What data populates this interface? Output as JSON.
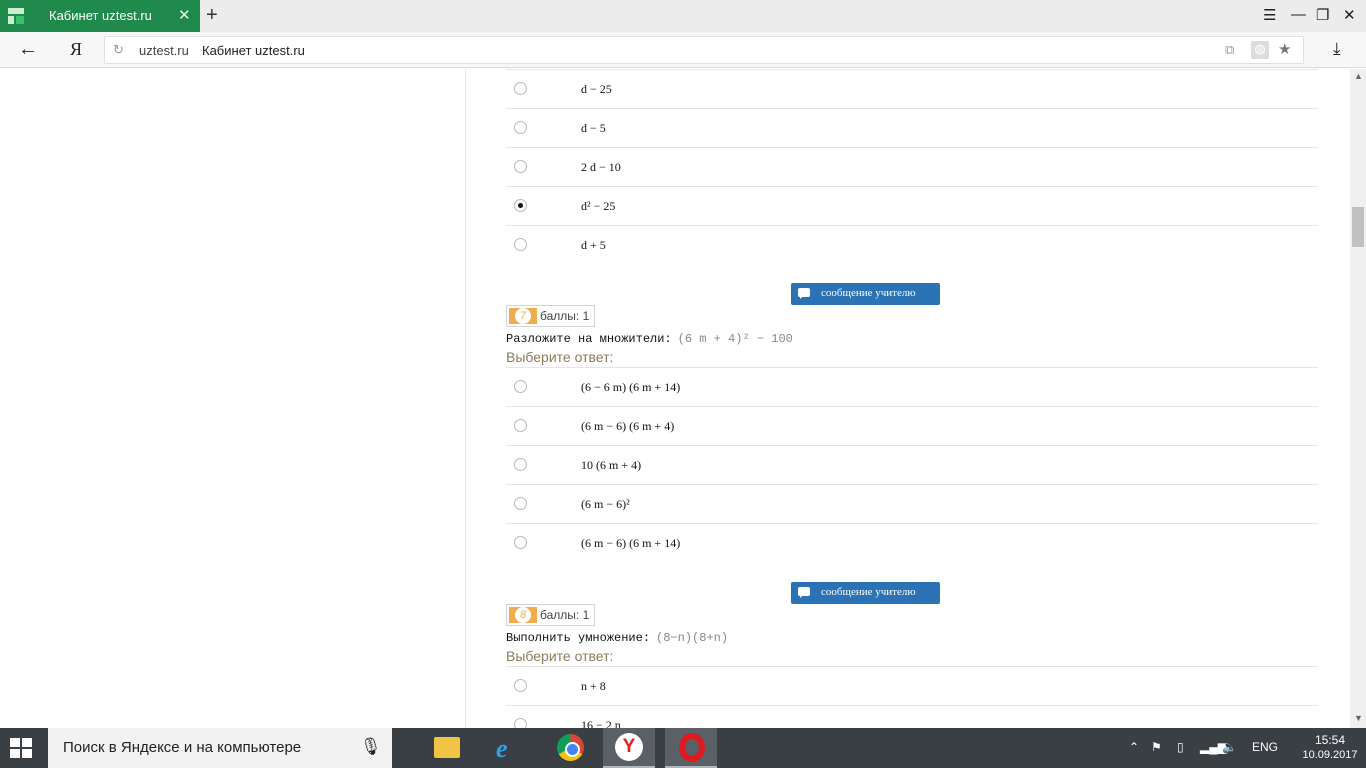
{
  "browser": {
    "tab_title": "Кабинет uztest.ru",
    "tab_close": "✕",
    "new_tab": "+",
    "host": "uztest.ru",
    "page_title": "Кабинет uztest.ru",
    "back_glyph": "←",
    "logo": "Я",
    "reload_glyph": "↻",
    "download_glyph": "⤓",
    "window_buttons": {
      "menu": "☰",
      "minimize": "—",
      "restore": "❐",
      "close": "✕"
    }
  },
  "questions": [
    {
      "answers": [
        {
          "text": "d − 25",
          "checked": false
        },
        {
          "text": "d − 5",
          "checked": false
        },
        {
          "text": "2 d − 10",
          "checked": false
        },
        {
          "text": "d² − 25",
          "checked": true
        },
        {
          "text": "d + 5",
          "checked": false
        }
      ]
    },
    {
      "message_button": "сообщение учителю",
      "number": "7",
      "points": "баллы: 1",
      "prompt": "Разложите на множители:",
      "formula": "(6 m + 4)² − 100",
      "choose_label": "Выберите ответ:",
      "answers": [
        {
          "text": "(6 − 6 m) (6 m + 14)",
          "checked": false
        },
        {
          "text": "(6 m − 6) (6 m + 4)",
          "checked": false
        },
        {
          "text": "10 (6 m + 4)",
          "checked": false
        },
        {
          "text": "(6 m − 6)²",
          "checked": false
        },
        {
          "text": "(6 m − 6) (6 m + 14)",
          "checked": false
        }
      ]
    },
    {
      "message_button": "сообщение учителю",
      "number": "8",
      "points": "баллы: 1",
      "prompt": "Выполнить умножение:",
      "formula": "(8−n)(8+n)",
      "choose_label": "Выберите ответ:",
      "answers": [
        {
          "text": "n + 8",
          "checked": false
        },
        {
          "text": "16 − 2 n",
          "checked": false
        }
      ]
    }
  ],
  "taskbar": {
    "search_placeholder": "Поиск в Яндексе и на компьютере",
    "apps": [
      "file-explorer",
      "internet-explorer",
      "chrome",
      "yandex-browser",
      "opera"
    ],
    "yandex_glyph": "Y",
    "ie_glyph": "e",
    "language": "ENG",
    "time": "15:54",
    "date": "10.09.2017"
  },
  "icons": {
    "message": "speech-bubble-icon",
    "start": "windows-logo-icon",
    "mic": "microphone-icon"
  }
}
